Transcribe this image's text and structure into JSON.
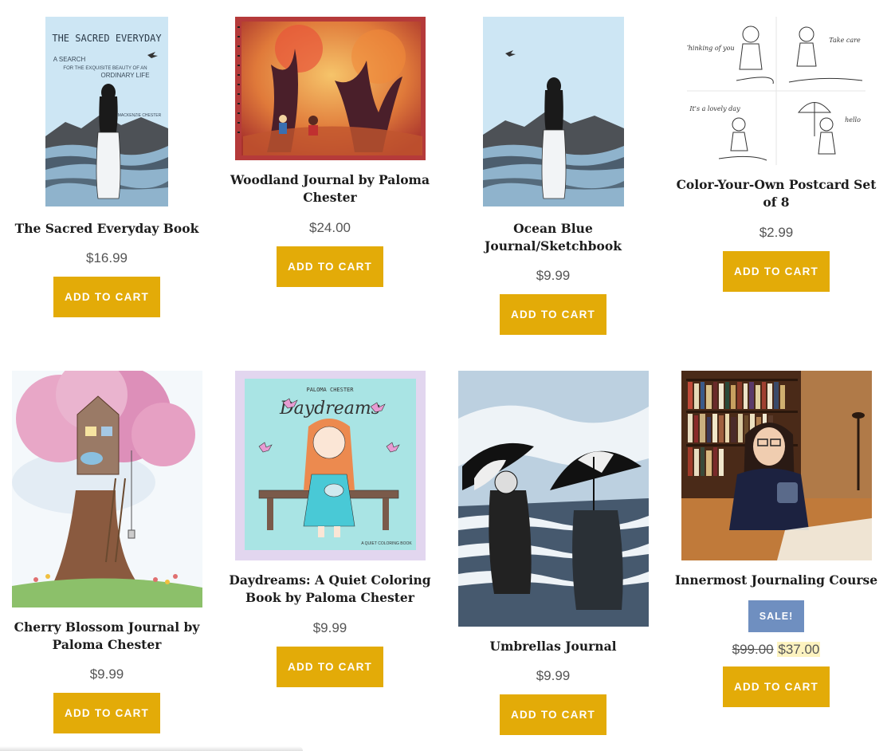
{
  "products": [
    {
      "title_line1": "The Sacred Everyday Book",
      "title_line2": "",
      "price": "$16.99",
      "button": "ADD TO CART",
      "cover_title": "THE SACRED EVERYDAY",
      "cover_sub1": "A SEARCH",
      "cover_sub2": "FOR THE EXQUISITE BEAUTY OF AN",
      "cover_sub3": "ORDINARY LIFE",
      "cover_author": "MACKENZIE CHESTER"
    },
    {
      "title_line1": "Woodland Journal by Paloma",
      "title_line2": "Chester",
      "price": "$24.00",
      "button": "ADD TO CART"
    },
    {
      "title_line1": "Ocean Blue",
      "title_line2": "Journal/Sketchbook",
      "price": "$9.99",
      "button": "ADD TO CART"
    },
    {
      "title_line1": "Color-Your-Own Postcard Set",
      "title_line2": "of 8",
      "price": "$2.99",
      "button": "ADD TO CART",
      "card1": "Thinking of you",
      "card2": "Take care",
      "card3": "It's a lovely day",
      "card4": "hello"
    },
    {
      "title_line1": "Cherry Blossom Journal by",
      "title_line2": "Paloma Chester",
      "price": "$9.99",
      "button": "ADD TO CART"
    },
    {
      "title_line1": "Daydreams: A Quiet Coloring",
      "title_line2": "Book by Paloma Chester",
      "price": "$9.99",
      "button": "ADD TO CART",
      "cover_author": "PALOMA CHESTER",
      "cover_title": "Daydreams",
      "cover_foot": "A QUIET COLORING BOOK"
    },
    {
      "title_line1": "Umbrellas Journal",
      "title_line2": "",
      "price": "$9.99",
      "button": "ADD TO CART"
    },
    {
      "title_line1": "Innermost Journaling Course",
      "title_line2": "",
      "sale_badge": "SALE!",
      "old_price": "$99.00",
      "new_price": "$37.00",
      "button": "ADD TO CART"
    }
  ]
}
